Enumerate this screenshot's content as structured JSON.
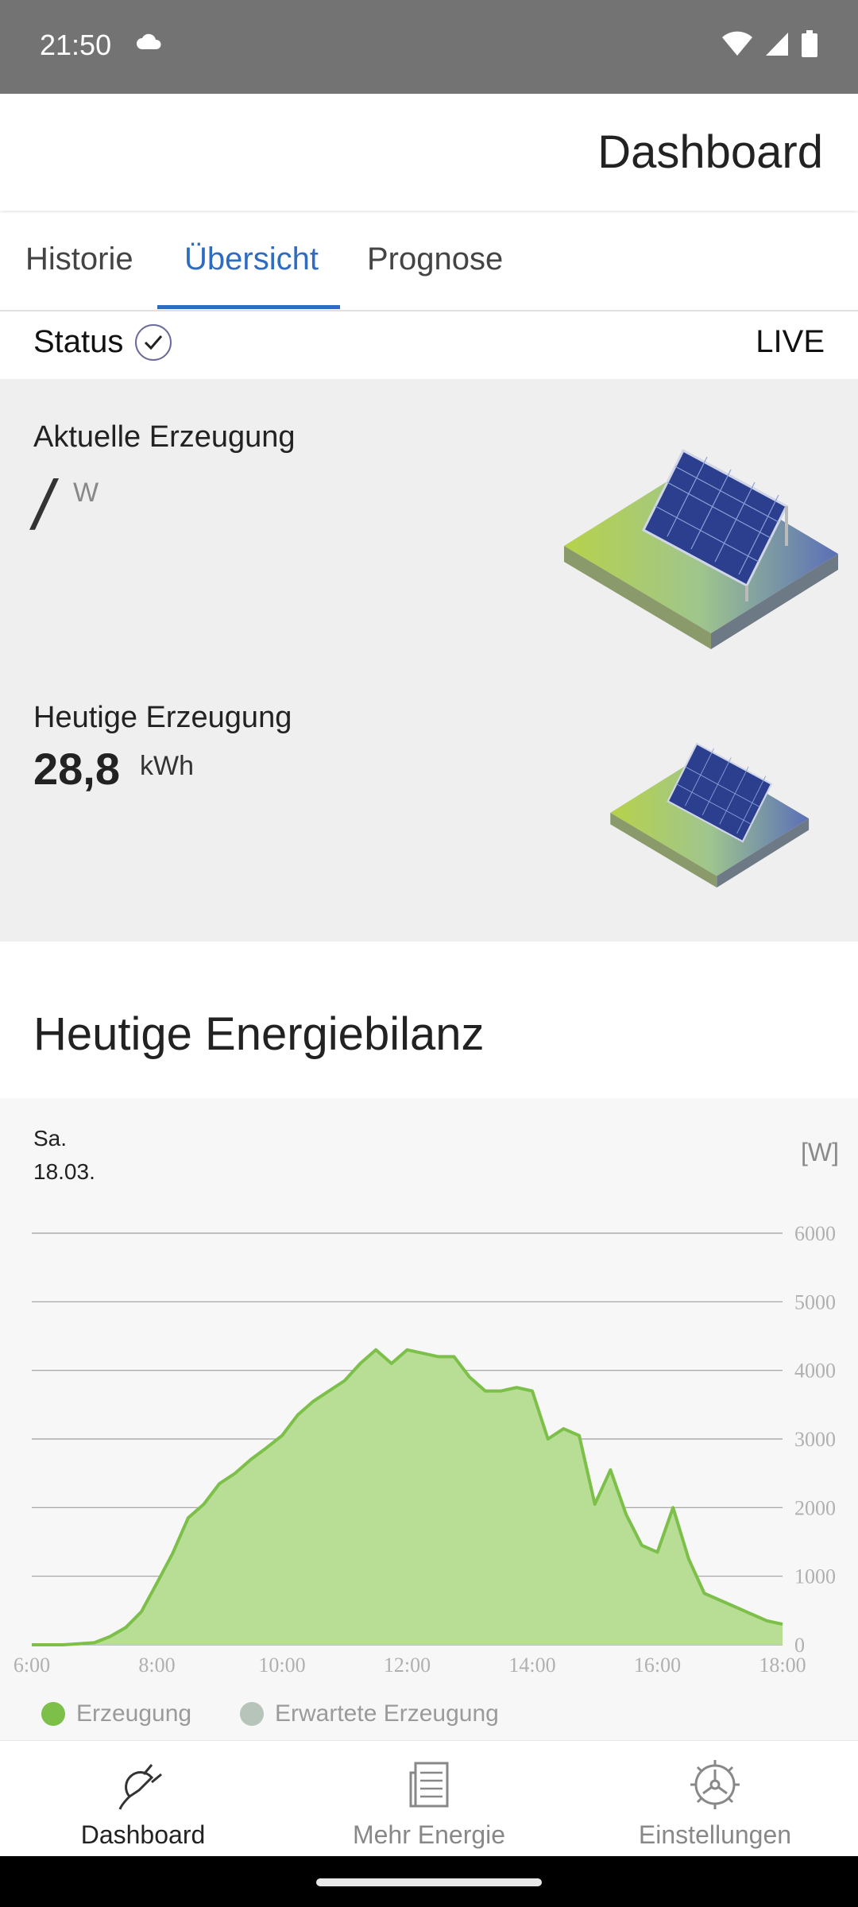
{
  "status_bar": {
    "time": "21:50"
  },
  "app_bar": {
    "title": "Dashboard"
  },
  "tabs": [
    {
      "label": "Historie",
      "active": false
    },
    {
      "label": "Übersicht",
      "active": true
    },
    {
      "label": "Prognose",
      "active": false
    }
  ],
  "status": {
    "label": "Status",
    "live": "LIVE"
  },
  "current_generation": {
    "label": "Aktuelle Erzeugung",
    "value": "/",
    "unit": "W"
  },
  "today_generation": {
    "label": "Heutige Erzeugung",
    "value": "28,8",
    "unit": "kWh"
  },
  "section": {
    "title": "Heutige Energiebilanz"
  },
  "chart_header": {
    "day": "Sa.",
    "date": "18.03.",
    "unit": "[W]"
  },
  "chart_data": {
    "type": "area",
    "x_ticks": [
      "6:00",
      "8:00",
      "10:00",
      "12:00",
      "14:00",
      "16:00",
      "18:00"
    ],
    "y_ticks": [
      0,
      1000,
      2000,
      3000,
      4000,
      5000,
      6000
    ],
    "ylim": [
      0,
      6000
    ],
    "xlim_hours": [
      6,
      18
    ],
    "grid": true,
    "series": [
      {
        "name": "Erzeugung",
        "color": "#7cc04a",
        "x_hours": [
          6.0,
          6.5,
          7.0,
          7.25,
          7.5,
          7.75,
          8.0,
          8.25,
          8.5,
          8.75,
          9.0,
          9.25,
          9.5,
          9.75,
          10.0,
          10.25,
          10.5,
          10.75,
          11.0,
          11.25,
          11.5,
          11.75,
          12.0,
          12.25,
          12.5,
          12.75,
          13.0,
          13.25,
          13.5,
          13.75,
          14.0,
          14.25,
          14.5,
          14.75,
          15.0,
          15.25,
          15.5,
          15.75,
          16.0,
          16.25,
          16.5,
          16.75,
          17.0,
          17.25,
          17.5,
          17.75,
          18.0
        ],
        "values": [
          0,
          0,
          30,
          120,
          250,
          480,
          900,
          1330,
          1850,
          2050,
          2350,
          2500,
          2700,
          2870,
          3050,
          3350,
          3550,
          3700,
          3850,
          4100,
          4300,
          4100,
          4300,
          4250,
          4200,
          4200,
          3900,
          3700,
          3700,
          3750,
          3700,
          3000,
          3150,
          3050,
          2050,
          2550,
          1900,
          1450,
          1350,
          2000,
          1250,
          750,
          650,
          550,
          450,
          350,
          300
        ]
      }
    ]
  },
  "legend": [
    {
      "label": "Erzeugung",
      "color": "#7cc04a"
    },
    {
      "label": "Erwartete Erzeugung",
      "color": "#b7c4b9"
    }
  ],
  "bottom_nav": [
    {
      "label": "Dashboard",
      "icon": "plug-icon",
      "active": true
    },
    {
      "label": "Mehr Energie",
      "icon": "newspaper-icon",
      "active": false
    },
    {
      "label": "Einstellungen",
      "icon": "gear-icon",
      "active": false
    }
  ]
}
